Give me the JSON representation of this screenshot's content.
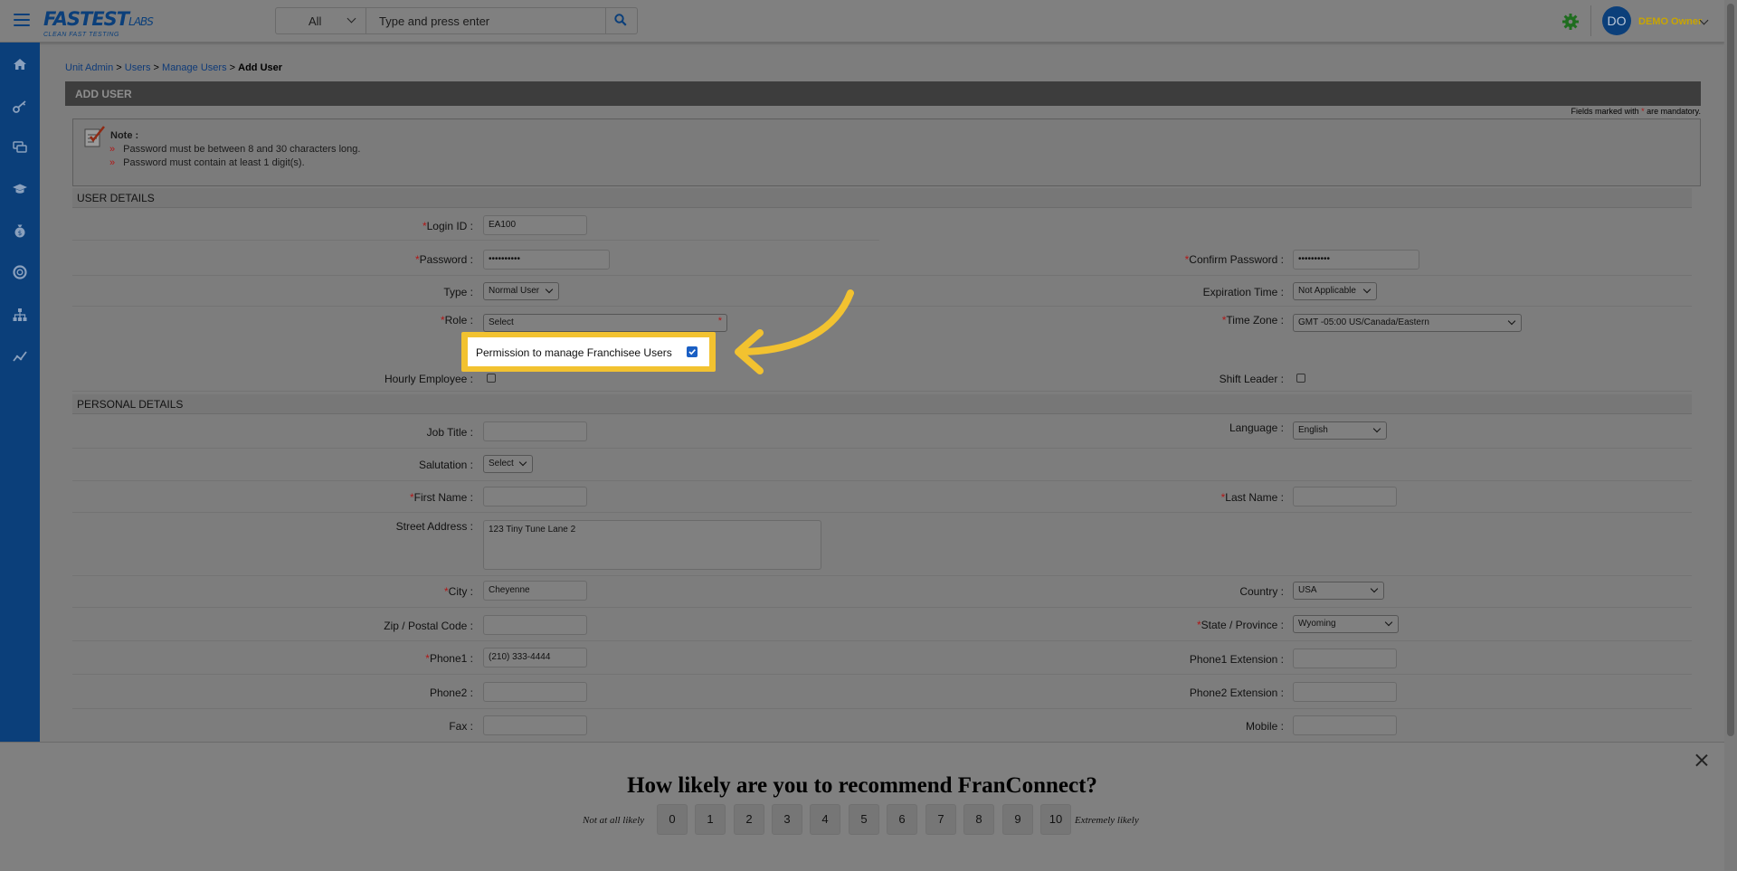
{
  "header": {
    "logo_main": "FASTEST",
    "logo_suffix": "LABS",
    "logo_tagline": "CLEAN FAST TESTING",
    "search_scope": "All",
    "search_placeholder": "Type and press enter",
    "user_initials": "DO",
    "user_name": "DEMO Owner"
  },
  "sidebar": {
    "icons": [
      "home-icon",
      "key-icon",
      "chat-icon",
      "graduation-cap-icon",
      "money-bag-icon",
      "support-icon",
      "org-chart-icon",
      "analytics-icon"
    ]
  },
  "breadcrumb": {
    "items": [
      "Unit Admin",
      "Users",
      "Manage Users"
    ],
    "separator": " > ",
    "current": "Add User"
  },
  "page": {
    "title": "ADD USER",
    "mandatory_prefix": "Fields marked with",
    "mandatory_star": "*",
    "mandatory_suffix": "are mandatory."
  },
  "note": {
    "heading": "Note :",
    "bullet": "»",
    "lines": [
      "Password must be between 8 and 30 characters long.",
      "Password must contain at least 1 digit(s)."
    ]
  },
  "user_details": {
    "heading": "USER DETAILS",
    "login_id_label": "Login ID :",
    "login_id_value": "EA100",
    "password_label": "Password :",
    "password_value": "••••••••••",
    "confirm_password_label": "Confirm Password :",
    "confirm_password_value": "••••••••••",
    "type_label": "Type :",
    "type_value": "Normal User",
    "expiration_label": "Expiration Time :",
    "expiration_value": "Not Applicable",
    "role_label": "Role :",
    "role_value": "Select",
    "timezone_label": "Time Zone :",
    "timezone_value": "GMT -05:00 US/Canada/Eastern",
    "permission_label": "Permission to manage Franchisee Users",
    "permission_checked": true,
    "hourly_label": "Hourly Employee :",
    "shift_leader_label": "Shift Leader :"
  },
  "personal_details": {
    "heading": "PERSONAL DETAILS",
    "job_title_label": "Job Title :",
    "language_label": "Language :",
    "language_value": "English",
    "salutation_label": "Salutation :",
    "salutation_value": "Select",
    "first_name_label": "First Name :",
    "last_name_label": "Last Name :",
    "street_label": "Street Address :",
    "street_value": "123 Tiny Tune Lane 2",
    "city_label": "City :",
    "city_value": "Cheyenne",
    "country_label": "Country :",
    "country_value": "USA",
    "zip_label": "Zip / Postal Code :",
    "state_label": "State / Province :",
    "state_value": "Wyoming",
    "phone1_label": "Phone1 :",
    "phone1_value": "(210) 333-4444",
    "phone1_ext_label": "Phone1 Extension :",
    "phone2_label": "Phone2 :",
    "phone2_ext_label": "Phone2 Extension :",
    "fax_label": "Fax :",
    "mobile_label": "Mobile :"
  },
  "survey": {
    "question": "How likely are you to recommend FranConnect?",
    "low_label": "Not at all likely",
    "high_label": "Extremely likely",
    "scores": [
      "0",
      "1",
      "2",
      "3",
      "4",
      "5",
      "6",
      "7",
      "8",
      "9",
      "10"
    ]
  },
  "colors": {
    "sidebar": "#0b3f7a",
    "highlight": "#f2c230",
    "required": "#b01818",
    "link": "#0e3a78"
  }
}
